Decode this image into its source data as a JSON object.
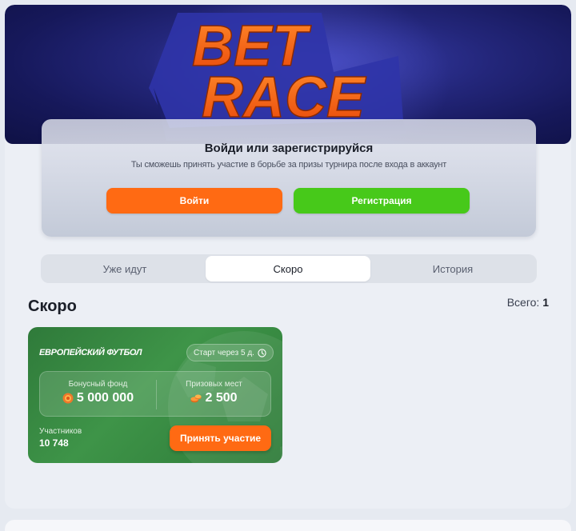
{
  "banner": {
    "logo_line1": "BET",
    "logo_line2": "RACE"
  },
  "auth": {
    "title": "Войди или зарегистрируйся",
    "subtitle": "Ты сможешь принять участие в борьбе за призы турнира после входа в аккаунт",
    "login_label": "Войти",
    "register_label": "Регистрация"
  },
  "tabs": [
    {
      "label": "Уже идут",
      "active": false
    },
    {
      "label": "Скоро",
      "active": true
    },
    {
      "label": "История",
      "active": false
    }
  ],
  "section": {
    "title": "Скоро",
    "total_label": "Всего:",
    "total_value": "1"
  },
  "tournament": {
    "name": "ЕВРОПЕЙСКИЙ ФУТБОЛ",
    "start_label": "Старт через 5 д.",
    "bonus_label": "Бонусный фонд",
    "bonus_value": "5 000 000",
    "places_label": "Призовых мест",
    "places_value": "2 500",
    "participants_label": "Участников",
    "participants_value": "10 748",
    "join_label": "Принять участие"
  },
  "colors": {
    "accent_orange": "#ff6a13",
    "accent_green": "#47c91a",
    "card_green": "#3e9448",
    "banner_blue": "#23267a"
  }
}
